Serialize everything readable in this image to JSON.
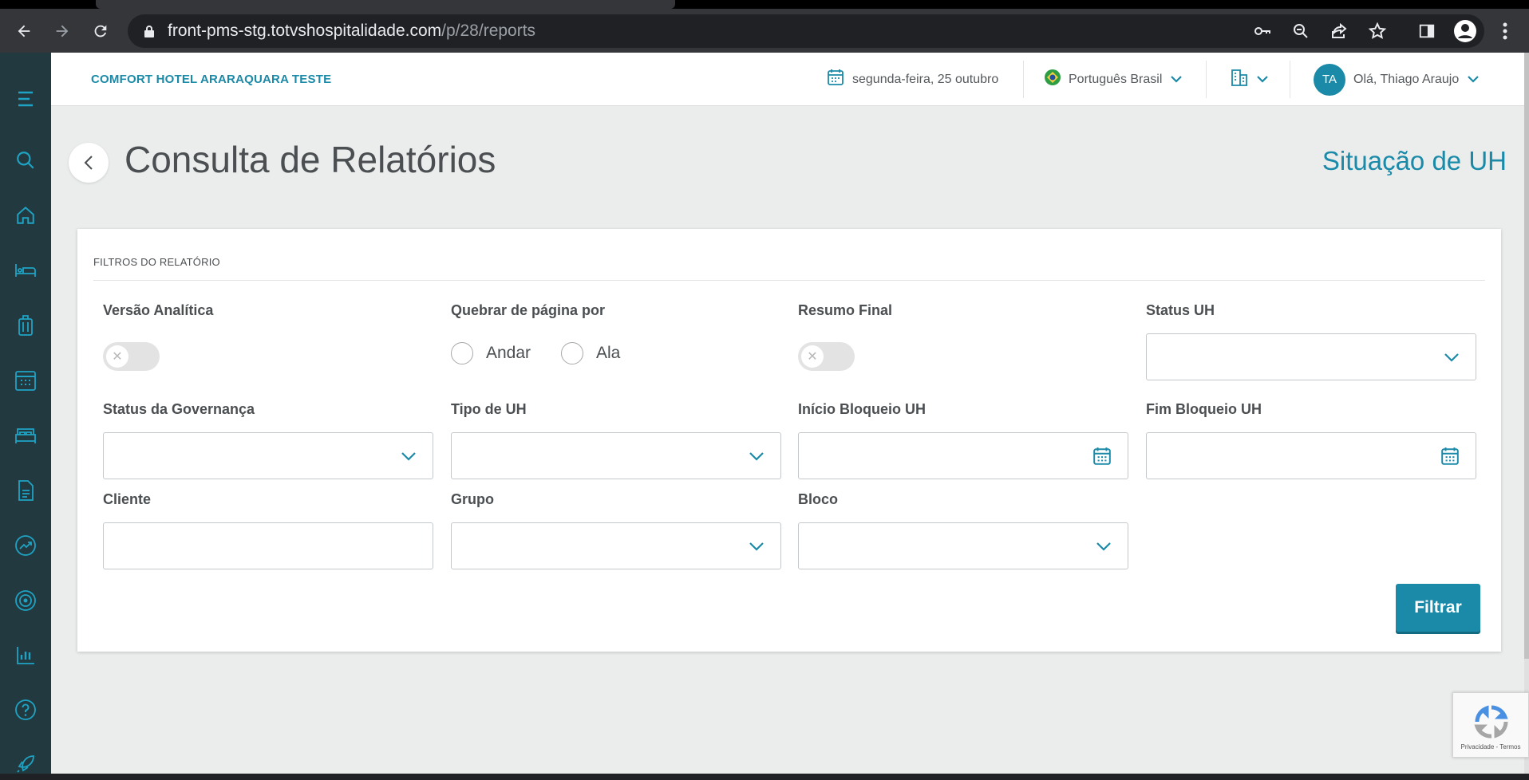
{
  "browser": {
    "url_host": "front-pms-stg.totvshospitalidade.com",
    "url_path": "/p/28/reports"
  },
  "header": {
    "hotel_name": "COMFORT HOTEL ARARAQUARA TESTE",
    "date": "segunda-feira, 25 outubro",
    "language": "Português Brasil",
    "avatar_initials": "TA",
    "greeting": "Olá, Thiago Araujo"
  },
  "page": {
    "title": "Consulta de Relatórios",
    "report_name": "Situação de UH"
  },
  "filters": {
    "section_title": "FILTROS DO RELATÓRIO",
    "versao_analitica": "Versão Analítica",
    "quebrar_pagina": "Quebrar de página por",
    "radio_andar": "Andar",
    "radio_ala": "Ala",
    "resumo_final": "Resumo Final",
    "status_uh": "Status UH",
    "status_governanca": "Status da Governança",
    "tipo_uh": "Tipo de UH",
    "inicio_bloqueio": "Início Bloqueio UH",
    "fim_bloqueio": "Fim Bloqueio UH",
    "cliente": "Cliente",
    "grupo": "Grupo",
    "bloco": "Bloco",
    "filter_button": "Filtrar"
  },
  "recaptcha": {
    "text": "Privacidade - Termos"
  },
  "colors": {
    "accent": "#1a8aa8",
    "sidebar": "#223a3f",
    "sidebar_icon": "#1fa3c4"
  }
}
